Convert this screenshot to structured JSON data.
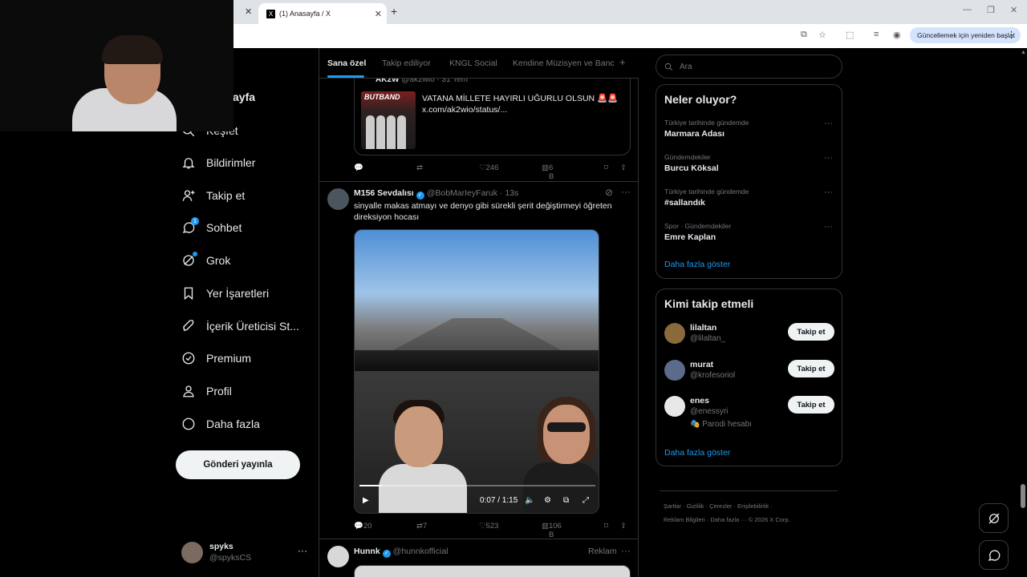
{
  "browser": {
    "tab_title": "(1) Anasayfa / X",
    "update_button": "Güncellemek için yeniden başlat"
  },
  "nav": {
    "home_partial": "ayfa",
    "explore_partial": "Keşfet",
    "items": [
      {
        "label": "Bildirimler",
        "icon": "bell-icon"
      },
      {
        "label": "Takip et",
        "icon": "follow-icon"
      },
      {
        "label": "Sohbet",
        "icon": "chat-icon",
        "badge": "1"
      },
      {
        "label": "Grok",
        "icon": "grok-icon"
      },
      {
        "label": "Yer İşaretleri",
        "icon": "bookmark-icon"
      },
      {
        "label": "İçerik Üreticisi St...",
        "icon": "rocket-icon"
      },
      {
        "label": "Premium",
        "icon": "verified-icon"
      },
      {
        "label": "Profil",
        "icon": "user-icon"
      },
      {
        "label": "Daha fazla",
        "icon": "more-circle-icon"
      }
    ],
    "post_button": "Gönderi yayınla",
    "account": {
      "name": "spyks",
      "handle": "@spyksCS"
    }
  },
  "timeline": {
    "tabs": [
      "Sana özel",
      "Takip ediliyor",
      "KNGL Social",
      "Kendine Müzisyen ve Banc"
    ],
    "quote": {
      "name": "AK2W",
      "handle": "@ak2wio · 31 Tem",
      "thumb_text": "BUTBAND",
      "text_line1": "VATANA MİLLETE HAYIRLI UĞURLU OLSUN 🚨🚨",
      "text_line2": "x.com/ak2wio/status/..."
    },
    "actions1": {
      "likes": "246",
      "views": "6 B"
    },
    "post": {
      "name": "M156 Sevdalısı",
      "handle": "@BobMarIeyFaruk · 13s",
      "text": "sinyalle makas atmayı ve denyo gibi sürekli şerit değiştirmeyi öğreten direksiyon hocası",
      "video_time": "0:07 / 1:15"
    },
    "actions2": {
      "replies": "20",
      "reposts": "7",
      "likes": "523",
      "views": "106 B"
    },
    "ad": {
      "name": "Hunnk",
      "handle": "@hunnkofficial",
      "label": "Reklam"
    }
  },
  "sidebar": {
    "search_placeholder": "Ara",
    "trends_title": "Neler oluyor?",
    "trends": [
      {
        "context": "Türkiye tarihinde gündemde",
        "name": "Marmara Adası"
      },
      {
        "context": "Gündemdekiler",
        "name": "Burcu Köksal"
      },
      {
        "context": "Türkiye tarihinde gündemde",
        "name": "#sallandık"
      },
      {
        "context": "Spor · Gündemdekiler",
        "name": "Emre Kaplan"
      }
    ],
    "show_more": "Daha fazla göster",
    "who_title": "Kimi takip etmeli",
    "who": [
      {
        "name": "lilaltan",
        "handle": "@lilaltan_",
        "button": "Takip et"
      },
      {
        "name": "murat",
        "handle": "@krofesoriol",
        "button": "Takip et"
      },
      {
        "name": "enes",
        "handle": "@enessyri",
        "extra": "Parodi hesabı",
        "button": "Takip et"
      }
    ],
    "show_more2": "Daha fazla göster",
    "footer_line1": "Şartlar  ·   Gizlilik  ·   Çerezler  ·   Erişilebilirlik  ·",
    "footer_line2": "Reklam Bilgileri  ·   Daha fazla ···   © 2026 X Corp."
  }
}
